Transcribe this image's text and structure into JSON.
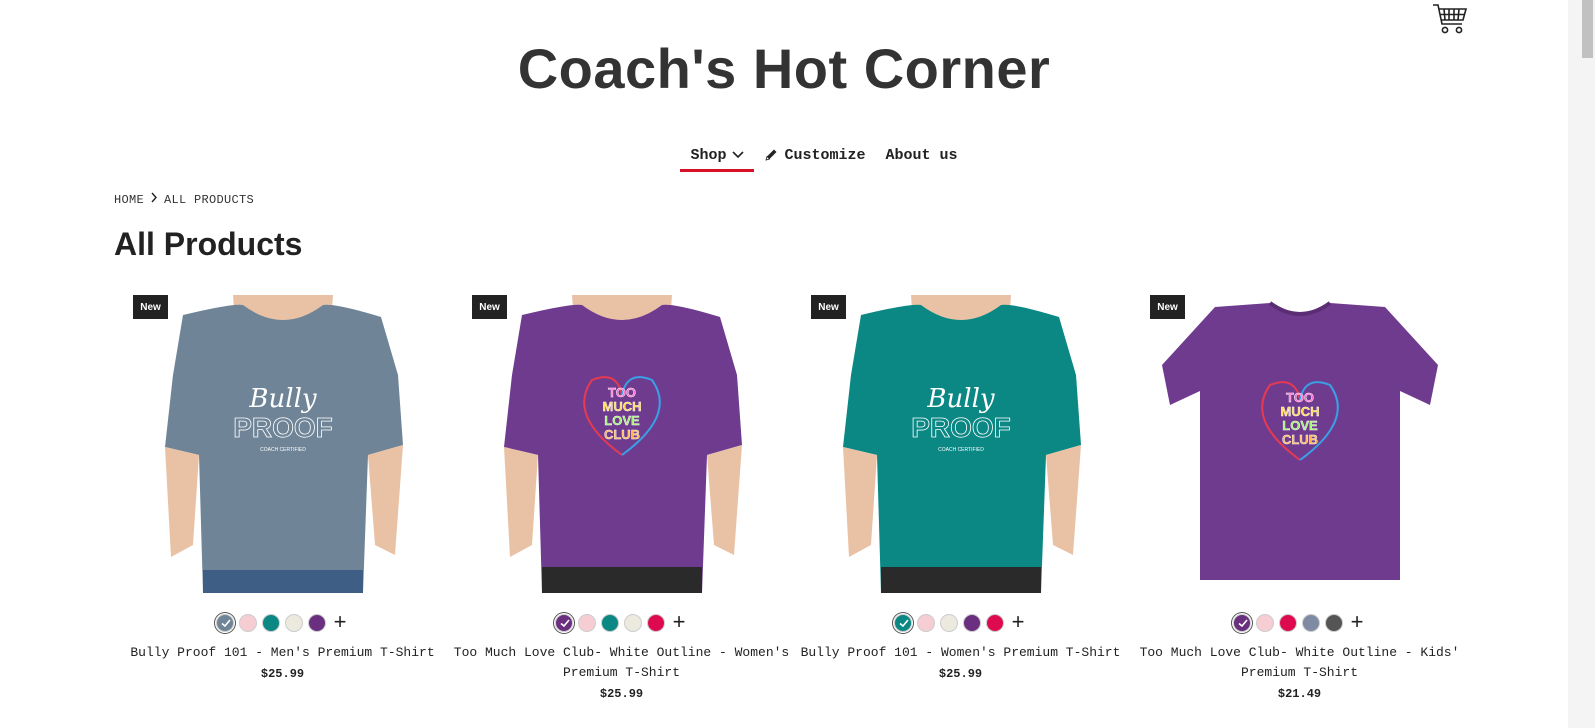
{
  "header": {
    "site_title": "Coach's Hot Corner",
    "cart_icon": "shopping-cart-icon"
  },
  "nav": {
    "shop": "Shop",
    "customize": "Customize",
    "about": "About us"
  },
  "breadcrumb": {
    "home": "HOME",
    "current": "ALL PRODUCTS"
  },
  "page_title": "All Products",
  "colors": {
    "accent": "#d7112a"
  },
  "products": [
    {
      "badge": "New",
      "name": "Bully Proof 101 - Men's Premium T-Shirt",
      "price": "$25.99",
      "shirt_color": "#6f8597",
      "swatches": [
        "#6f8597",
        "#f6cdd3",
        "#0b8784",
        "#ece9df",
        "#6a2f7e"
      ]
    },
    {
      "badge": "New",
      "name": "Too Much Love Club- White Outline - Women's Premium T-Shirt",
      "price": "$25.99",
      "shirt_color": "#6f3b8f",
      "swatches": [
        "#6a2f7e",
        "#f6cdd3",
        "#0b8784",
        "#ece9df",
        "#dd0a4f"
      ]
    },
    {
      "badge": "New",
      "name": "Bully Proof 101 - Women's Premium T-Shirt",
      "price": "$25.99",
      "shirt_color": "#0b8784",
      "swatches": [
        "#0b8784",
        "#f6cdd3",
        "#ece9df",
        "#6a2f7e",
        "#dd0a4f"
      ]
    },
    {
      "badge": "New",
      "name": "Too Much Love Club- White Outline - Kids' Premium T-Shirt",
      "price": "$21.49",
      "shirt_color": "#6f3b8f",
      "swatches": [
        "#6a2f7e",
        "#f6cdd3",
        "#dd0a4f",
        "#7e8ba3",
        "#555555"
      ]
    }
  ]
}
